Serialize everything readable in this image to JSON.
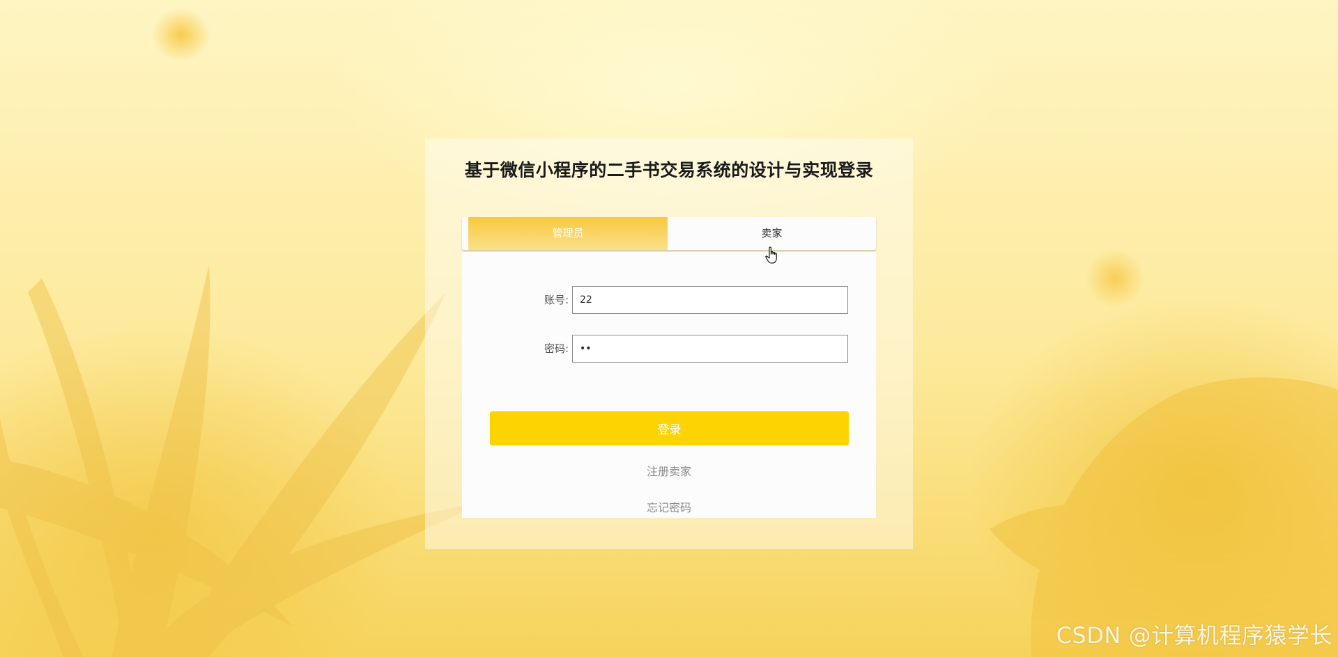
{
  "page": {
    "title": "基于微信小程序的二手书交易系统的设计与实现登录"
  },
  "tabs": [
    {
      "label": "管理员",
      "active": true
    },
    {
      "label": "卖家",
      "active": false
    }
  ],
  "form": {
    "account": {
      "label": "账号:",
      "value": "22"
    },
    "password": {
      "label": "密码:",
      "value": "••"
    }
  },
  "actions": {
    "login_label": "登录",
    "register_label": "注册卖家",
    "forgot_label": "忘记密码"
  },
  "watermark": "CSDN @计算机程序猿学长",
  "colors": {
    "accent": "#fed400",
    "active_tab": "#f7c93d"
  }
}
